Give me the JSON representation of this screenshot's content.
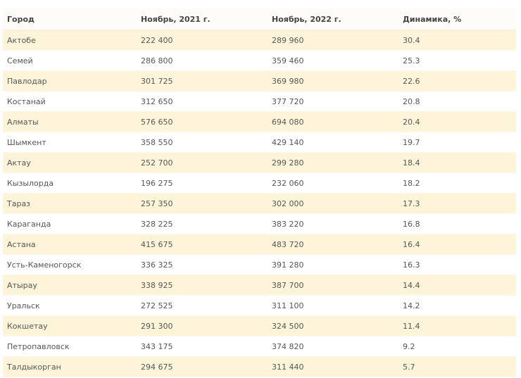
{
  "table": {
    "headers": [
      "Город",
      "Ноябрь, 2021 г.",
      "Ноябрь, 2022 г.",
      "Динамика, %"
    ],
    "rows": [
      [
        "Актобе",
        "222 400",
        "289 960",
        "30.4"
      ],
      [
        "Семей",
        "286 800",
        "359 460",
        "25.3"
      ],
      [
        "Павлодар",
        "301 725",
        "369 980",
        "22.6"
      ],
      [
        "Костанай",
        "312 650",
        "377 720",
        "20.8"
      ],
      [
        "Алматы",
        "576 650",
        "694 080",
        "20.4"
      ],
      [
        "Шымкент",
        "358 550",
        "429 140",
        "19.7"
      ],
      [
        "Актау",
        "252 700",
        "299 280",
        "18.4"
      ],
      [
        "Кызылорда",
        "196 275",
        "232 060",
        "18.2"
      ],
      [
        "Тараз",
        "257 350",
        "302 000",
        "17.3"
      ],
      [
        "Караганда",
        "328 225",
        "383 220",
        "16.8"
      ],
      [
        "Астана",
        "415 675",
        "483 720",
        "16.4"
      ],
      [
        "Усть-Каменогорск",
        "336 325",
        "391 280",
        "16.3"
      ],
      [
        "Атырау",
        "338 925",
        "387 700",
        "14.4"
      ],
      [
        "Уральск",
        "272 525",
        "311 100",
        "14.2"
      ],
      [
        "Кокшетау",
        "291 300",
        "324 500",
        "11.4"
      ],
      [
        "Петропавловск",
        "343 175",
        "374 820",
        "9.2"
      ],
      [
        "Талдыкорган",
        "294 675",
        "311 440",
        "5.7"
      ]
    ]
  },
  "colors": {
    "stripe": "#fdf4d9",
    "header_text": "#444444",
    "cell_text": "#555555"
  }
}
